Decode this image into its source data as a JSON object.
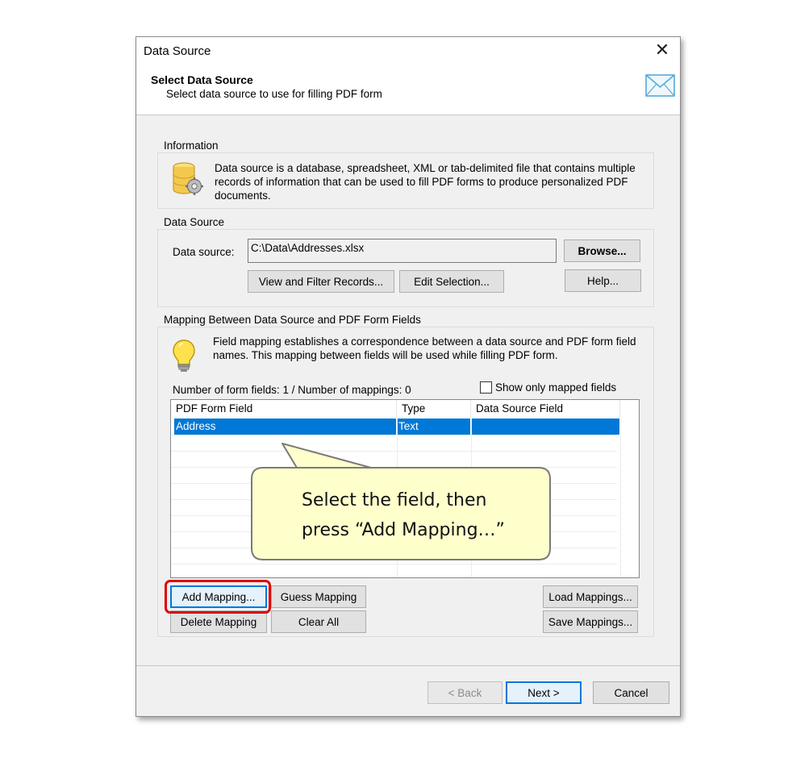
{
  "window": {
    "title": "Data Source",
    "close_symbol": "✕"
  },
  "header": {
    "title": "Select Data Source",
    "subtitle": "Select data source to use for filling PDF form",
    "icon": "envelope-icon"
  },
  "information": {
    "group_label": "Information",
    "icon": "database-gear-icon",
    "lines": [
      "Data source is a database, spreadsheet, XML or tab-delimited file that contains multiple",
      "records of information that can be used to fill PDF forms to produce personalized PDF",
      "documents."
    ]
  },
  "data_source": {
    "group_label": "Data Source",
    "field_label": "Data source:",
    "field_value": "C:\\Data\\Addresses.xlsx",
    "browse_label": "Browse...",
    "view_filter_label": "View and Filter Records...",
    "edit_selection_label": "Edit Selection...",
    "help_label": "Help..."
  },
  "mapping": {
    "group_label": "Mapping Between Data Source and PDF Form Fields",
    "icon": "lightbulb-icon",
    "lines": [
      "Field mapping establishes a correspondence between a data source and PDF form field",
      "names. This mapping between fields will be used while filling PDF form."
    ],
    "counts": "Number of form fields: 1 / Number of mappings: 0",
    "show_mapped_label": "Show only mapped fields",
    "show_mapped_checked": false,
    "columns": [
      "PDF Form Field",
      "Type",
      "Data Source Field"
    ],
    "rows": [
      {
        "field": "Address",
        "type": "Text",
        "source": "",
        "selected": true
      }
    ],
    "buttons": {
      "add": "Add Mapping...",
      "guess": "Guess Mapping",
      "delete": "Delete Mapping",
      "clear": "Clear All",
      "load": "Load Mappings...",
      "save": "Save Mappings..."
    }
  },
  "footer": {
    "back": "< Back",
    "next": "Next >",
    "cancel": "Cancel"
  },
  "callout": {
    "line1": "Select the field, then",
    "line2": "press “Add Mapping…”",
    "highlight_color": "#e00000",
    "fill_color": "#ffffcc"
  },
  "colors": {
    "selection": "#0078d7",
    "dialog_bg": "#f0f0f0",
    "focus_border": "#0078d7"
  }
}
